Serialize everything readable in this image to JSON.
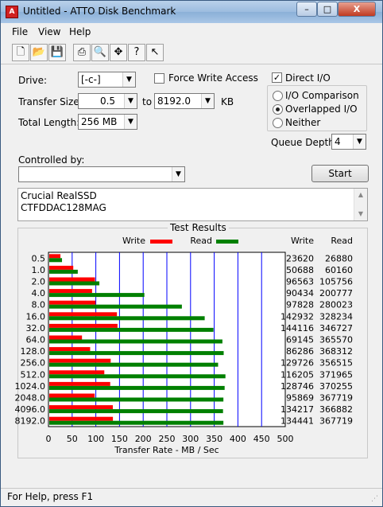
{
  "window": {
    "title": "Untitled - ATTO Disk Benchmark",
    "minimize": "–",
    "maximize": "□",
    "close": "X"
  },
  "menu": {
    "file": "File",
    "view": "View",
    "help": "Help"
  },
  "toolbar": [
    "new-icon",
    "open-icon",
    "save-icon",
    "print-icon",
    "print-preview-icon",
    "move-icon",
    "help-icon",
    "context-help-icon"
  ],
  "form": {
    "drive_label": "Drive:",
    "drive_value": "[-c-]",
    "transfer_size_label": "Transfer Size:",
    "transfer_from": "0.5",
    "to_label": "to",
    "transfer_to": "8192.0",
    "kb_label": "KB",
    "total_length_label": "Total Length:",
    "total_length_value": "256 MB",
    "force_write_label": "Force Write Access",
    "direct_io_label": "Direct I/O",
    "direct_io_checked": "✓",
    "io_comparison_label": "I/O Comparison",
    "overlapped_io_label": "Overlapped I/O",
    "neither_label": "Neither",
    "queue_depth_label": "Queue Depth:",
    "queue_depth_value": "4",
    "controlled_by_label": "Controlled by:",
    "controlled_by_value": "",
    "start_label": "Start",
    "description_line1": "Crucial RealSSD",
    "description_line2": "CTFDDAC128MAG"
  },
  "results": {
    "title": "Test Results",
    "write_legend": "Write",
    "read_legend": "Read",
    "write_col": "Write",
    "read_col": "Read"
  },
  "chart_data": {
    "type": "bar",
    "xlabel": "Transfer Rate - MB / Sec",
    "xlim": [
      0,
      500
    ],
    "x_ticks": [
      "0",
      "50",
      "100",
      "150",
      "200",
      "250",
      "300",
      "350",
      "400",
      "450",
      "500"
    ],
    "categories": [
      "0.5",
      "1.0",
      "2.0",
      "4.0",
      "8.0",
      "16.0",
      "32.0",
      "64.0",
      "128.0",
      "256.0",
      "512.0",
      "1024.0",
      "2048.0",
      "4096.0",
      "8192.0"
    ],
    "series": [
      {
        "name": "Write",
        "color": "#ff0000",
        "values": [
          23.6,
          50.7,
          96.6,
          90.4,
          97.8,
          142.9,
          144.1,
          69.1,
          86.3,
          129.7,
          116.2,
          128.7,
          95.9,
          134.2,
          134.4
        ]
      },
      {
        "name": "Read",
        "color": "#008000",
        "values": [
          26.9,
          60.2,
          105.8,
          200.8,
          280.0,
          328.2,
          346.7,
          365.6,
          368.3,
          356.5,
          372.0,
          370.3,
          367.7,
          366.9,
          367.7
        ]
      }
    ],
    "write_text": [
      "23620",
      "50688",
      "96563",
      "90434",
      "97828",
      "142932",
      "144116",
      "69145",
      "86286",
      "129726",
      "116205",
      "128746",
      "95869",
      "134217",
      "134441"
    ],
    "read_text": [
      "26880",
      "60160",
      "105756",
      "200777",
      "280023",
      "328234",
      "346727",
      "365570",
      "368312",
      "356515",
      "371965",
      "370255",
      "367719",
      "366882",
      "367719"
    ]
  },
  "status": {
    "text": "For Help, press F1"
  }
}
